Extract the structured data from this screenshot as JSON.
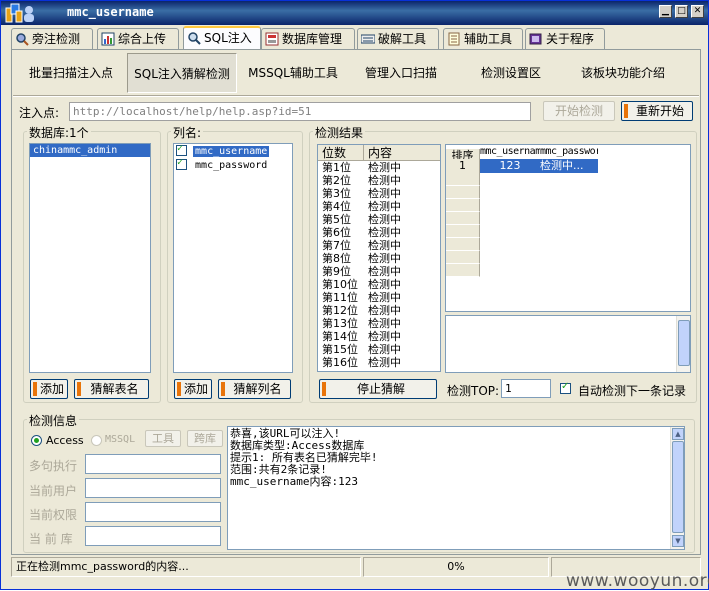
{
  "window": {
    "title": "mmc_username"
  },
  "tabs": [
    {
      "label": "旁注检测",
      "icon": "search-icon"
    },
    {
      "label": "综合上传",
      "icon": "upload-icon"
    },
    {
      "label": "SQL注入",
      "icon": "magnifier-icon"
    },
    {
      "label": "数据库管理",
      "icon": "database-icon"
    },
    {
      "label": "破解工具",
      "icon": "keyboard-icon"
    },
    {
      "label": "辅助工具",
      "icon": "notepad-icon"
    },
    {
      "label": "关于程序",
      "icon": "book-icon"
    }
  ],
  "subnav": [
    "批量扫描注入点",
    "SQL注入猜解检测",
    "MSSQL辅助工具",
    "管理入口扫描",
    "检测设置区",
    "该板块功能介绍"
  ],
  "injection": {
    "label": "注入点:",
    "url": "http://localhost/help/help.asp?id=51",
    "start_button": "开始检测",
    "restart_button": "重新开始"
  },
  "databases": {
    "label": "数据库:1个",
    "items": [
      "chinammc_admin"
    ],
    "add_button": "添加",
    "guess_button": "猜解表名"
  },
  "columns": {
    "label": "列名:",
    "items": [
      "mmc_username",
      "mmc_password"
    ],
    "add_button": "添加",
    "guess_button": "猜解列名"
  },
  "results": {
    "label": "检测结果",
    "headers": [
      "位数",
      "内容"
    ],
    "rows": [
      [
        "第1位",
        "检测中"
      ],
      [
        "第2位",
        "检测中"
      ],
      [
        "第3位",
        "检测中"
      ],
      [
        "第4位",
        "检测中"
      ],
      [
        "第5位",
        "检测中"
      ],
      [
        "第6位",
        "检测中"
      ],
      [
        "第7位",
        "检测中"
      ],
      [
        "第8位",
        "检测中"
      ],
      [
        "第9位",
        "检测中"
      ],
      [
        "第10位",
        "检测中"
      ],
      [
        "第11位",
        "检测中"
      ],
      [
        "第12位",
        "检测中"
      ],
      [
        "第13位",
        "检测中"
      ],
      [
        "第14位",
        "检测中"
      ],
      [
        "第15位",
        "检测中"
      ],
      [
        "第16位",
        "检测中"
      ]
    ],
    "stop_button": "停止猜解",
    "top_label": "检测TOP:",
    "top_value": "1",
    "auto_next_label": "自动检测下一条记录"
  },
  "records": {
    "sort_header": "排序",
    "headers": [
      "mmc_username",
      "mmc_password"
    ],
    "row": {
      "index": "1",
      "username": "123",
      "password": "检测中..."
    }
  },
  "info": {
    "label": "检测信息",
    "access_label": "Access",
    "mssql_label": "MSSQL",
    "tools_button": "工具",
    "crossdb_button": "跨库",
    "fields": [
      "多句执行",
      "当前用户",
      "当前权限",
      "当 前 库"
    ],
    "log": [
      "恭喜,该URL可以注入!",
      "数据库类型:Access数据库",
      "提示1: 所有表名已猜解完毕!",
      "范围:共有2条记录!",
      "mmc_username内容:123"
    ]
  },
  "statusbar": {
    "message": "正在检测mmc_password的内容...",
    "progress": "0%"
  },
  "watermark": "www.wooyun.org"
}
